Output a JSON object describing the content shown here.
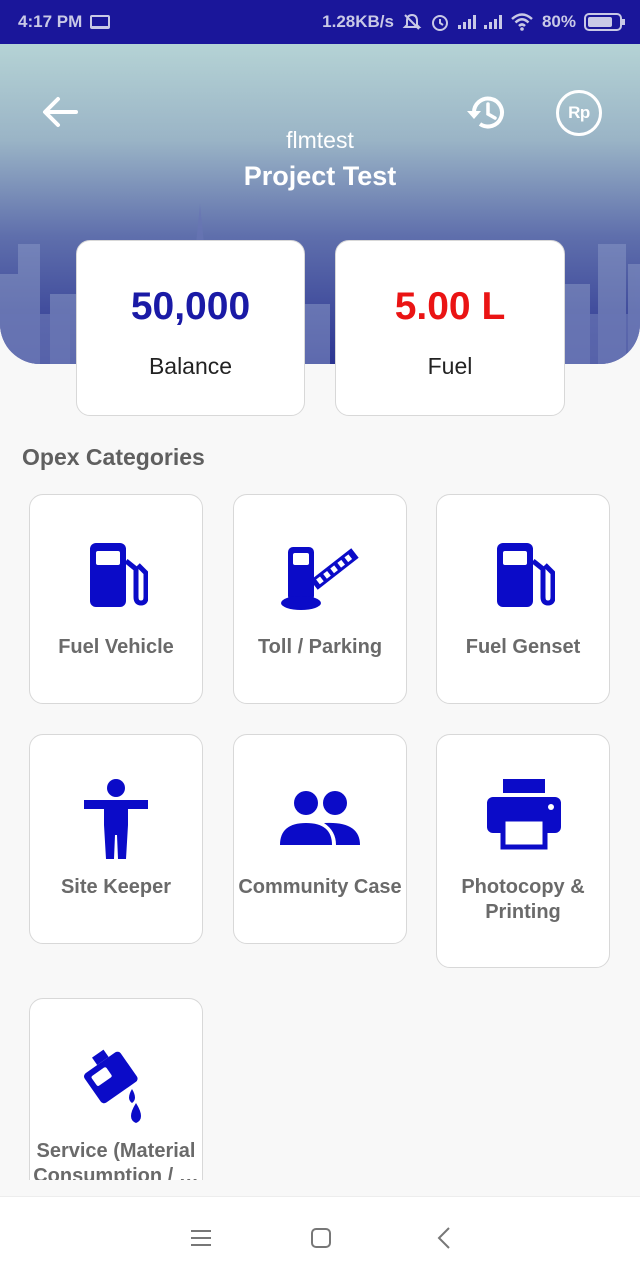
{
  "status_bar": {
    "time": "4:17 PM",
    "network_speed": "1.28KB/s",
    "battery": "80%",
    "battery_level": 0.8,
    "icons": [
      "laptop-icon",
      "mute-icon",
      "alarm-icon",
      "signal-icon",
      "signal-icon",
      "wifi-icon",
      "battery-icon"
    ]
  },
  "header": {
    "subtitle": "flmtest",
    "title": "Project Test",
    "currency_label": "Rp",
    "icons": [
      "back-arrow-icon",
      "history-icon",
      "rupiah-icon"
    ]
  },
  "stats": {
    "balance": {
      "value": "50,000",
      "label": "Balance"
    },
    "fuel": {
      "value": "5.00 L",
      "label": "Fuel"
    }
  },
  "section": {
    "title": "Opex Categories"
  },
  "categories": [
    {
      "label": "Fuel Vehicle",
      "icon": "fuel-pump-icon"
    },
    {
      "label": "Toll / Parking",
      "icon": "toll-gate-icon"
    },
    {
      "label": "Fuel Genset",
      "icon": "fuel-pump-icon"
    },
    {
      "label": "Site Keeper",
      "icon": "person-icon"
    },
    {
      "label": "Community Case",
      "icon": "people-icon"
    },
    {
      "label": "Photocopy & Printing",
      "icon": "printer-icon"
    },
    {
      "label": "Service (Material Consumption / …",
      "icon": "oil-can-icon"
    }
  ],
  "nav": {
    "icons": [
      "menu-icon",
      "home-icon",
      "back-icon"
    ]
  },
  "colors": {
    "status_bar": "#1a169a",
    "accent_blue": "#1a1aa6",
    "icon_blue": "#0b0bc8",
    "fuel_red": "#ea1414",
    "label_gray": "#6a6a6a"
  }
}
